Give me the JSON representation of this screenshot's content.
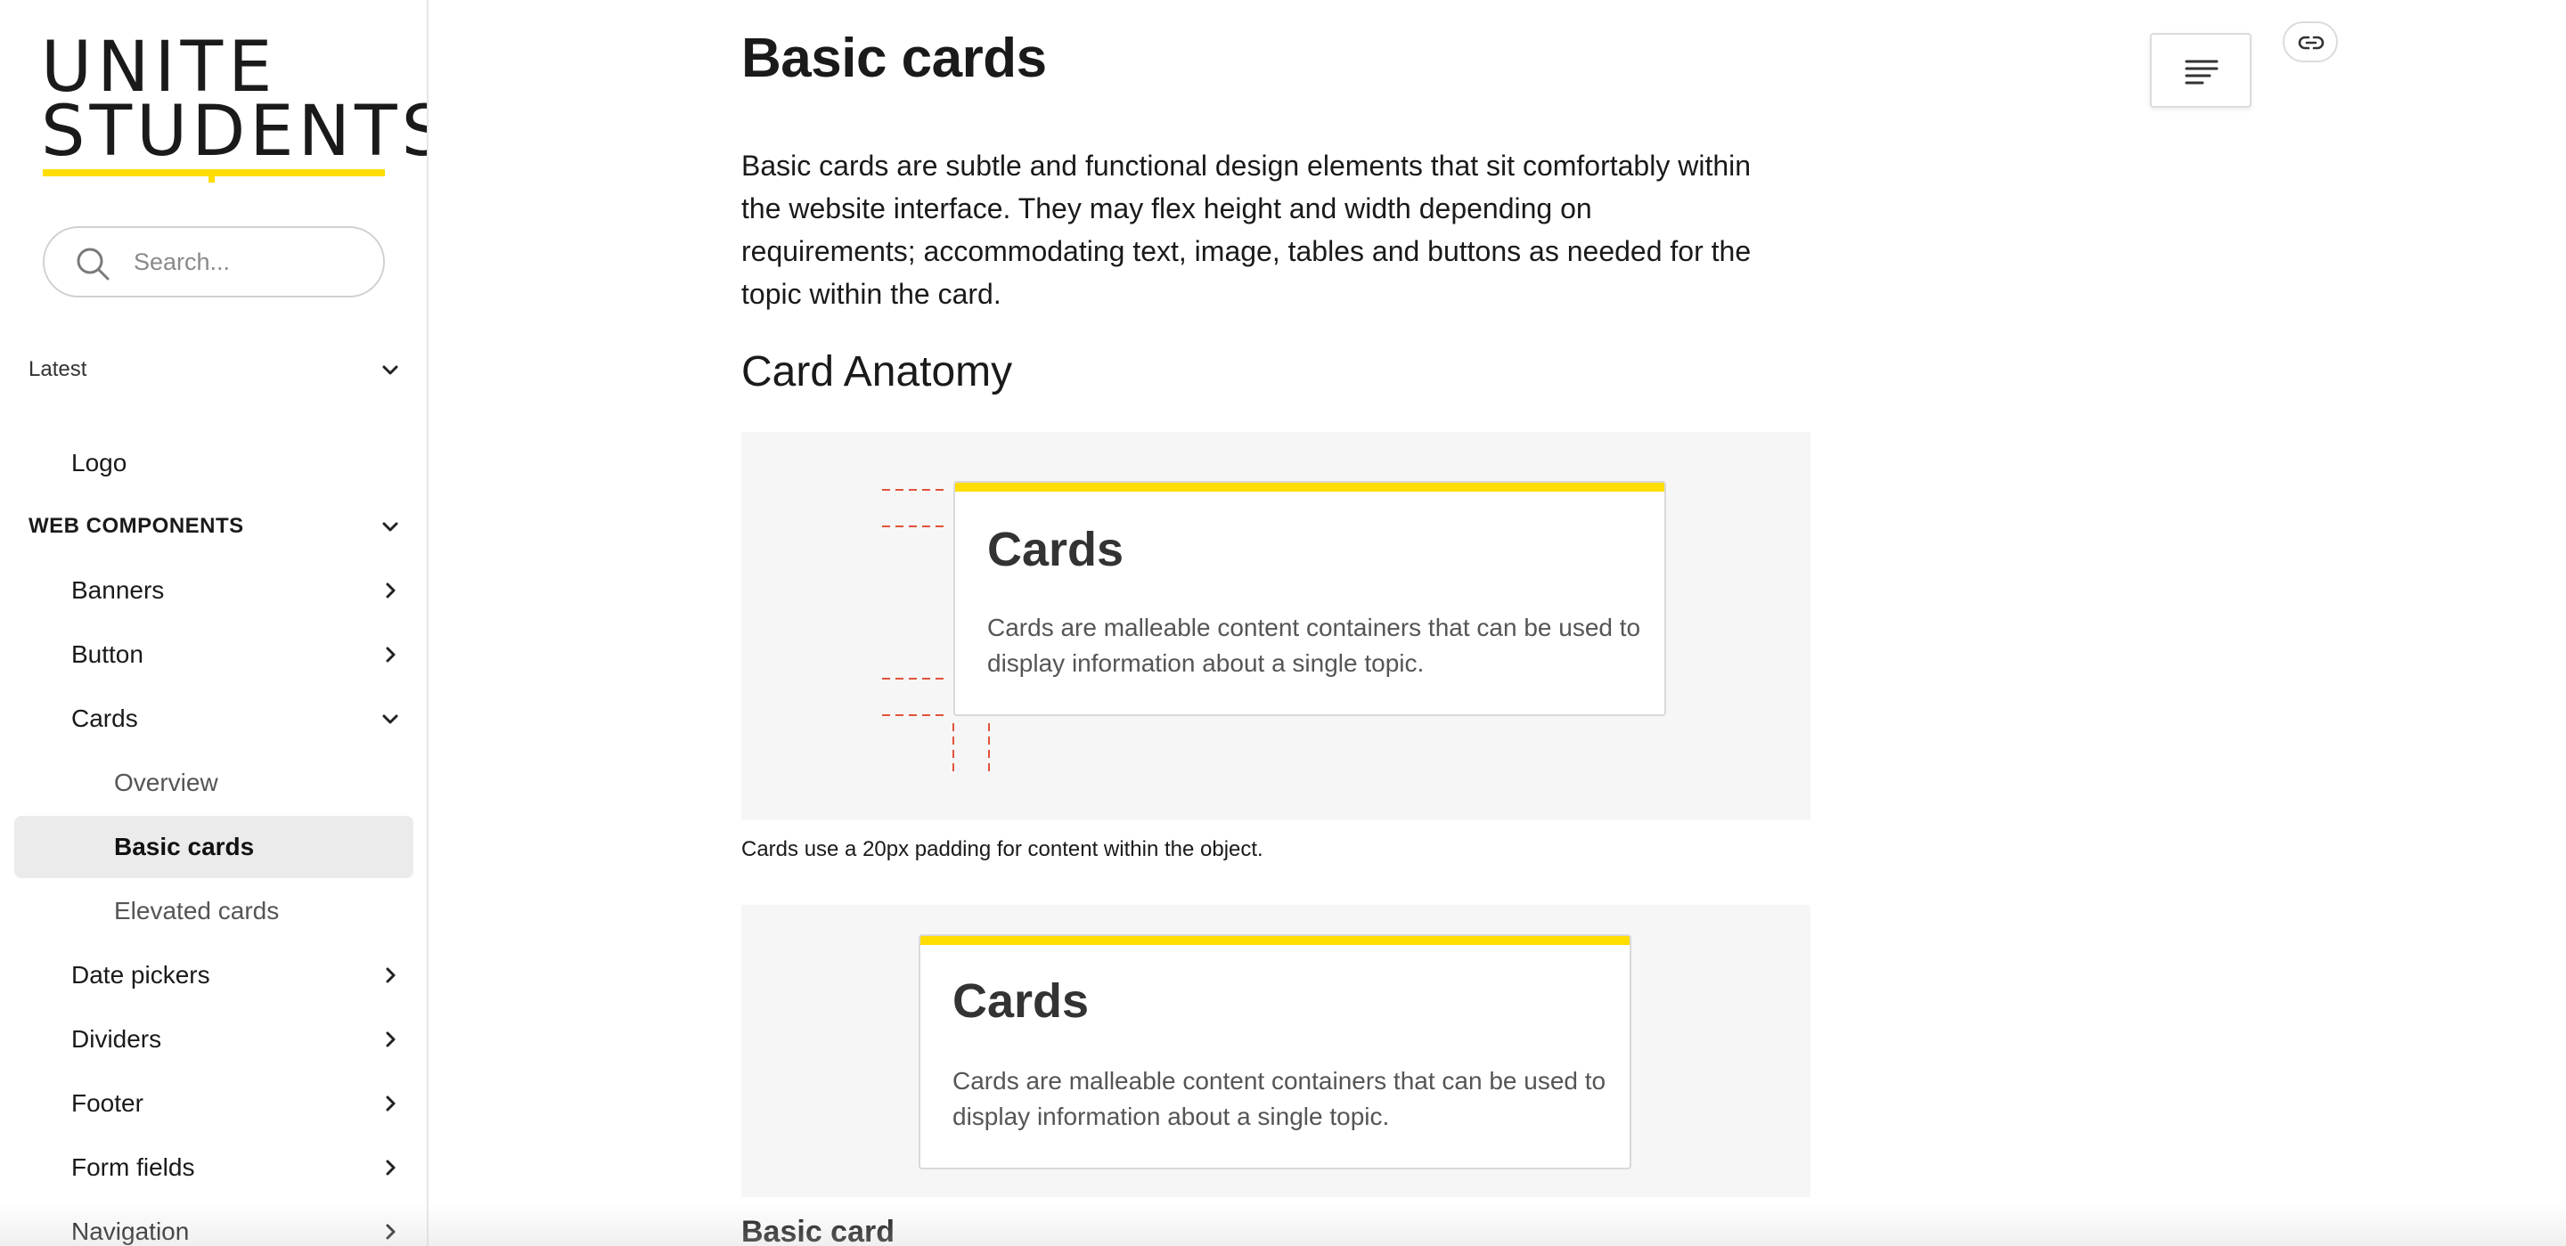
{
  "sidebar": {
    "logo": {
      "line1": "UNITE",
      "line2": "STUDENTS",
      "accent_color": "#ffdd00"
    },
    "search": {
      "placeholder": "Search...",
      "icon": "search-icon"
    },
    "nav": {
      "latest": "Latest",
      "logo": "Logo",
      "web_components": "WEB COMPONENTS",
      "banners": "Banners",
      "button": "Button",
      "cards": "Cards",
      "overview": "Overview",
      "basic_cards": "Basic cards",
      "elevated_cards": "Elevated cards",
      "date_pickers": "Date pickers",
      "dividers": "Dividers",
      "footer": "Footer",
      "form_fields": "Form fields",
      "navigation": "Navigation"
    },
    "active_item": "Basic cards"
  },
  "main": {
    "title": "Basic cards",
    "intro": "Basic cards are subtle and functional design elements that sit comfortably within the website interface. They may flex height and width depending on requirements; accommodating text, image, tables and buttons as needed for the topic within the card.",
    "section_heading": "Card Anatomy",
    "example_card": {
      "title": "Cards",
      "text": "Cards are malleable content containers that can be used to display information about a single topic.",
      "accent_color": "#ffdd00"
    },
    "padding_caption": "Cards use a 20px padding for content within the object.",
    "subheading": "Basic card"
  },
  "toolbar": {
    "toc_icon": "table-of-contents-icon",
    "link_icon": "link-icon"
  },
  "colors": {
    "brand_yellow": "#ffdd00",
    "guide_red": "#e0533a",
    "demo_bg": "#f6f6f6"
  }
}
